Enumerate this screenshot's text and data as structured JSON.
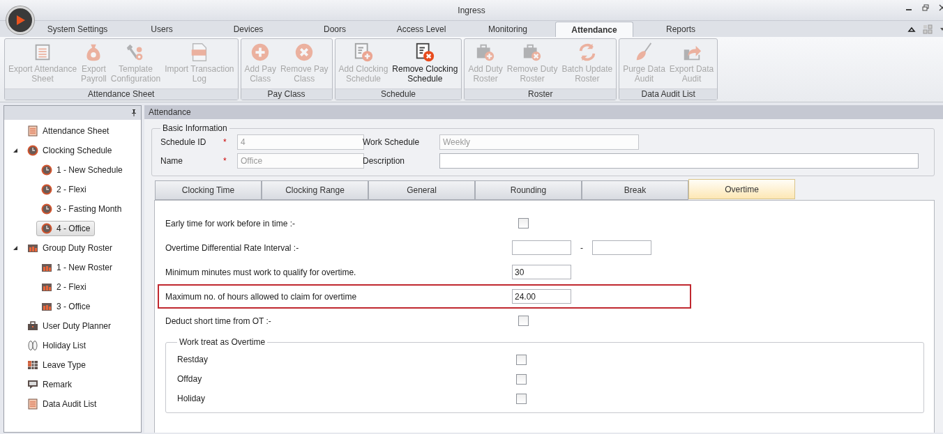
{
  "window": {
    "title": "Ingress"
  },
  "menu_tabs": [
    {
      "label": "System Settings",
      "selected": false
    },
    {
      "label": "Users",
      "selected": false
    },
    {
      "label": "Devices",
      "selected": false
    },
    {
      "label": "Doors",
      "selected": false
    },
    {
      "label": "Access Level",
      "selected": false
    },
    {
      "label": "Monitoring",
      "selected": false
    },
    {
      "label": "Attendance",
      "selected": true
    },
    {
      "label": "Reports",
      "selected": false
    }
  ],
  "ribbon_groups": [
    {
      "label": "Attendance Sheet",
      "buttons": [
        {
          "label": "Export Attendance\nSheet",
          "disabled": true
        },
        {
          "label": "Export\nPayroll",
          "disabled": true
        },
        {
          "label": "Template\nConfiguration",
          "disabled": true
        },
        {
          "label": "Import Transaction\nLog",
          "disabled": true
        }
      ]
    },
    {
      "label": "Pay Class",
      "buttons": [
        {
          "label": "Add Pay\nClass",
          "disabled": true
        },
        {
          "label": "Remove Pay\nClass",
          "disabled": true
        }
      ]
    },
    {
      "label": "Schedule",
      "buttons": [
        {
          "label": "Add Clocking\nSchedule",
          "disabled": true
        },
        {
          "label": "Remove Clocking\nSchedule",
          "disabled": false
        }
      ]
    },
    {
      "label": "Roster",
      "buttons": [
        {
          "label": "Add Duty\nRoster",
          "disabled": true
        },
        {
          "label": "Remove Duty\nRoster",
          "disabled": true
        },
        {
          "label": "Batch Update\nRoster",
          "disabled": true
        }
      ]
    },
    {
      "label": "Data Audit List",
      "buttons": [
        {
          "label": "Purge Data\nAudit",
          "disabled": true
        },
        {
          "label": "Export Data\nAudit",
          "disabled": true
        }
      ]
    }
  ],
  "sidebar": {
    "items": [
      {
        "label": "Attendance Sheet",
        "kind": "sheet",
        "selected": false
      },
      {
        "label": "Clocking Schedule",
        "kind": "schedule",
        "selected": false,
        "expanded": true,
        "children": [
          {
            "label": "1 - New Schedule",
            "kind": "schedule",
            "selected": false
          },
          {
            "label": "2 - Flexi",
            "kind": "schedule",
            "selected": false
          },
          {
            "label": "3 - Fasting Month",
            "kind": "schedule",
            "selected": false
          },
          {
            "label": "4 - Office",
            "kind": "schedule",
            "selected": true
          }
        ]
      },
      {
        "label": "Group Duty Roster",
        "kind": "roster",
        "selected": false,
        "expanded": true,
        "children": [
          {
            "label": "1 - New Roster",
            "kind": "roster",
            "selected": false
          },
          {
            "label": "2 - Flexi",
            "kind": "roster",
            "selected": false
          },
          {
            "label": "3 - Office",
            "kind": "roster",
            "selected": false
          }
        ]
      },
      {
        "label": "User Duty Planner",
        "kind": "planner",
        "selected": false
      },
      {
        "label": "Holiday List",
        "kind": "holiday",
        "selected": false
      },
      {
        "label": "Leave Type",
        "kind": "leave",
        "selected": false
      },
      {
        "label": "Remark",
        "kind": "remark",
        "selected": false
      },
      {
        "label": "Data Audit List",
        "kind": "audit",
        "selected": false
      }
    ]
  },
  "panel": {
    "title": "Attendance",
    "basic_information": {
      "legend": "Basic Information",
      "fields": [
        {
          "label": "Schedule ID",
          "marker": "*",
          "value": "4",
          "disabled": true
        },
        {
          "label": "Work Schedule",
          "value": "Weekly",
          "disabled": true
        },
        {
          "label": "Name",
          "marker": "*",
          "value": "Office",
          "disabled": true
        },
        {
          "label": "Description",
          "disabled": false
        }
      ]
    },
    "tabs": [
      {
        "label": "Clocking Time",
        "selected": false
      },
      {
        "label": "Clocking Range",
        "selected": false
      },
      {
        "label": "General",
        "selected": false
      },
      {
        "label": "Rounding",
        "selected": false
      },
      {
        "label": "Break",
        "selected": false
      },
      {
        "label": "Overtime",
        "selected": true
      }
    ],
    "overtime_rows": [
      {
        "kind": "checkbox",
        "label": "Early time for work before in time :-",
        "checked": false,
        "highlighted": false
      },
      {
        "kind": "range",
        "label": "Overtime Differential Rate Interval :-",
        "separator": "-",
        "highlighted": false
      },
      {
        "kind": "text",
        "label": "Minimum minutes must work to qualify for overtime.",
        "value": "30",
        "highlighted": false
      },
      {
        "kind": "text",
        "label": "Maximum no. of hours allowed to claim for overtime",
        "value": "24.00",
        "highlighted": true
      },
      {
        "kind": "checkbox",
        "label": "Deduct short time from OT :-",
        "checked": false,
        "highlighted": false
      }
    ],
    "work_treat_as_overtime": {
      "legend": "Work treat as Overtime",
      "rows": [
        {
          "label": "Restday",
          "checked": false
        },
        {
          "label": "Offday",
          "checked": false
        },
        {
          "label": "Holiday",
          "checked": false
        }
      ]
    }
  }
}
